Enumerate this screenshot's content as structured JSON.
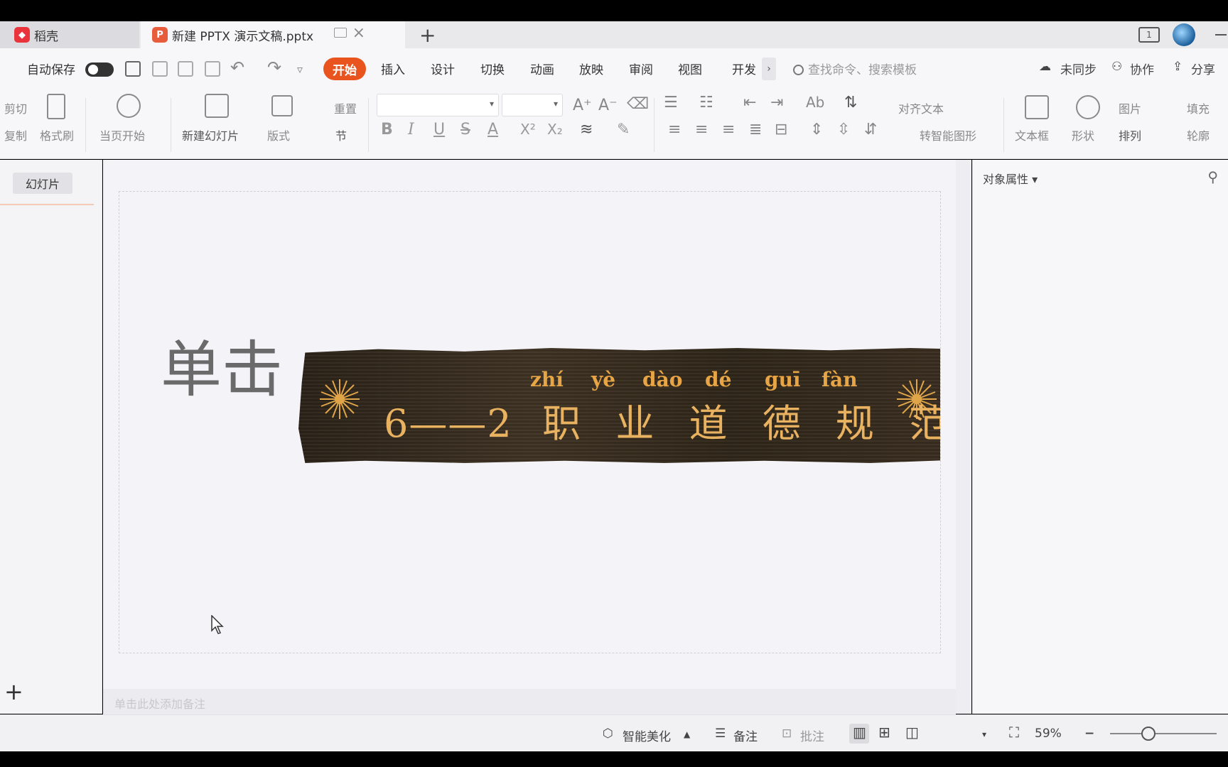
{
  "tabs": {
    "docer_label": "稻壳",
    "doc_label": "新建 PPTX 演示文稿.pptx",
    "add": "+"
  },
  "menubar": {
    "autosave": "自动保存",
    "items": [
      "开始",
      "插入",
      "设计",
      "切换",
      "动画",
      "放映",
      "审阅",
      "视图",
      "开发"
    ],
    "more": "›",
    "search_placeholder": "查找命令、搜索模板",
    "sync": "未同步",
    "collab": "协作",
    "share": "分享"
  },
  "ribbon": {
    "cut": "剪切",
    "copy": "复制",
    "format_painter": "格式刷",
    "play_from_current": "当页开始",
    "new_slide": "新建幻灯片",
    "layout": "版式",
    "reset": "重置",
    "section": "节",
    "align_text": "对齐文本",
    "smart_shape": "转智能图形",
    "textbox": "文本框",
    "shape": "形状",
    "picture": "图片",
    "arrange": "排列",
    "fill": "填充",
    "outline": "轮廓",
    "bold": "B",
    "italic": "I",
    "underline": "U",
    "strike": "S",
    "font_color": "A",
    "superscript": "X²",
    "subscript": "X₂",
    "grow_font": "A⁺",
    "shrink_font": "A⁻"
  },
  "left_panel": {
    "slides_tab": "幻灯片",
    "add": "+"
  },
  "slide": {
    "placeholder_title": "单击",
    "pinyin": [
      "zhí",
      "yè",
      "dào",
      "dé",
      "guī",
      "fàn"
    ],
    "number": "6——2",
    "title_chars": [
      "职",
      "业",
      "道",
      "德",
      "规",
      "范"
    ]
  },
  "notes": {
    "placeholder": "单击此处添加备注"
  },
  "right_panel": {
    "title": "对象属性 ▾"
  },
  "statusbar": {
    "beautify": "智能美化",
    "notes": "备注",
    "comments": "批注",
    "zoom": "59%"
  },
  "colors": {
    "accent": "#e9541e",
    "banner_text": "#e8b260",
    "pinyin": "#e7a546"
  }
}
